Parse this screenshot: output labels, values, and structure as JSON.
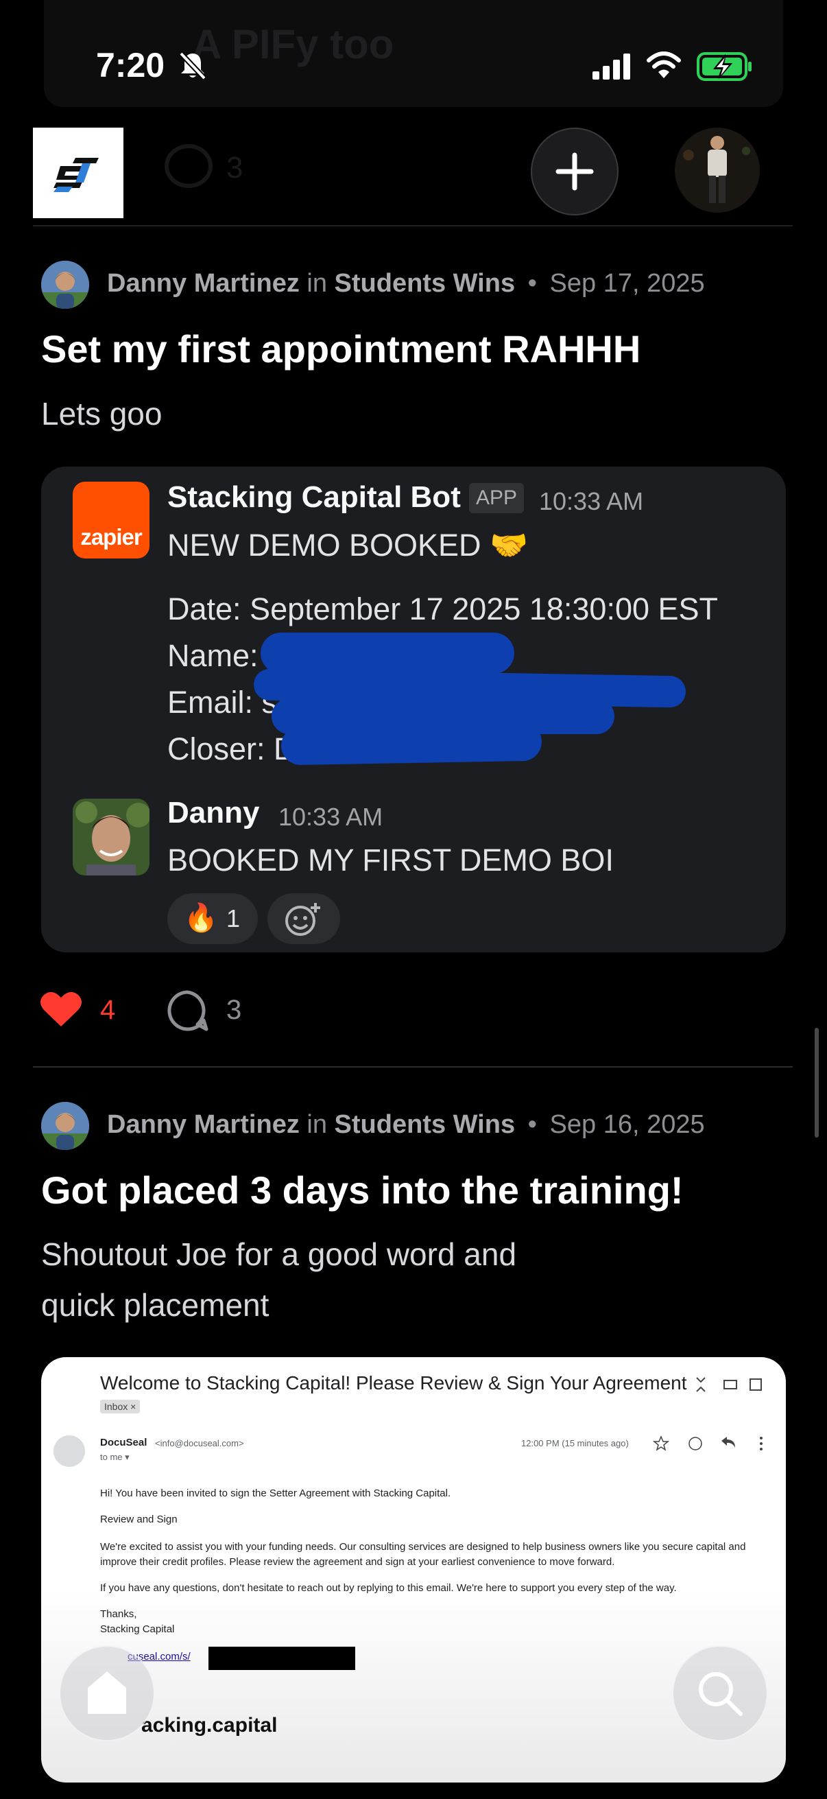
{
  "status_bar": {
    "time": "7:20"
  },
  "ghost_post": {
    "title": "A PIFy too",
    "comment_count": "3"
  },
  "posts": [
    {
      "author": "Danny Martinez",
      "in_text": "in",
      "group": "Students Wins",
      "date": "Sep 17, 2025",
      "title": "Set my first appointment RAHHH",
      "body": "Lets goo",
      "likes": "4",
      "comments": "3"
    },
    {
      "author": "Danny Martinez",
      "in_text": "in",
      "group": "Students Wins",
      "date": "Sep 16, 2025",
      "title": "Got placed 3 days into the training!",
      "body_line1": "Shoutout Joe for a good word and",
      "body_line2": "quick placement"
    }
  ],
  "slack": {
    "bot_name": "Stacking Capital Bot",
    "app_badge": "APP",
    "bot_time": "10:33 AM",
    "bot_logo_text": "zapier",
    "headline": "NEW DEMO BOOKED 🤝",
    "date_line": "Date: September 17 2025 18:30:00 EST",
    "name_label": "Name: N",
    "email_label": "Email: sa",
    "closer_label": "Closer: D",
    "user_name": "Danny",
    "user_time": "10:33 AM",
    "user_message": "BOOKED MY FIRST DEMO BOI",
    "reaction_emoji": "🔥",
    "reaction_count": "1"
  },
  "email": {
    "subject": "Welcome to Stacking Capital! Please Review & Sign Your Agreement",
    "inbox_tag": "Inbox ×",
    "sender": "DocuSeal",
    "sender_email": "<info@docuseal.com>",
    "to": "to me ▾",
    "time": "12:00 PM (15 minutes ago)",
    "line1": "Hi! You have been invited to sign the Setter Agreement with Stacking Capital.",
    "line2": "Review and Sign",
    "line3": "We're excited to assist you with your funding needs. Our consulting services are designed to help business owners like you secure capital and",
    "line4": "improve their credit profiles. Please review the agreement and sign at your earliest convenience to move forward.",
    "line5": "If you have any questions, don't hesitate to reach out by replying to this email. We're here to support you every step of the way.",
    "line6": "Thanks,",
    "line7": "Stacking Capital",
    "link": "cuseal.com/s/",
    "footer": "acking.capital"
  },
  "colors": {
    "like": "#ff3b30",
    "zapier": "#ff4f00",
    "redaction": "#0e3fae"
  }
}
